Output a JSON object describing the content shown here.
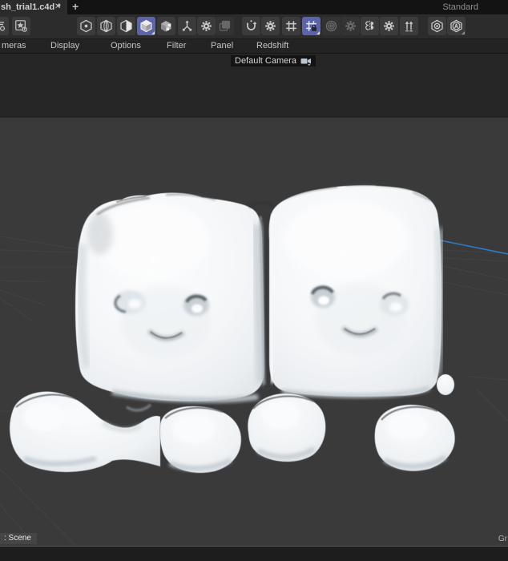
{
  "tab_bar": {
    "tab_title": "sh_trial1.c4d *",
    "close_label": "✕",
    "new_tab_label": "+",
    "layout_label": "Standard"
  },
  "toolbar": {
    "icons": [
      "truncated-left-icon",
      "asset-capsule-icon",
      "shading-dot-hexagon-icon",
      "shading-line-hexagon-icon",
      "shading-half-hexagon-icon",
      "shading-solid-cube-icon",
      "shading-broken-cube-icon",
      "move-axes-icon",
      "move-settings-gear-icon",
      "layers-icon",
      "rotate-u-icon",
      "rotate-settings-gear-icon",
      "grid-icon",
      "grid-lock-icon",
      "rings-icon",
      "rings-settings-gear-icon",
      "symmetry-icon",
      "symmetry-settings-gear-icon",
      "swap-up-arrows-icon",
      "hexagon-eye-icon",
      "hexagon-auto-icon"
    ],
    "selected_color": "#5b63ab"
  },
  "menu_bar": {
    "items": [
      "meras",
      "Display",
      "Options",
      "Filter",
      "Panel",
      "Redshift"
    ]
  },
  "viewport": {
    "camera_label": "Default Camera",
    "bg_top_color": "#262626",
    "bg_bottom_color": "#3a3a3a",
    "grid_line_color": "#4a4a4a",
    "axis_z_color": "#2e7bc5"
  },
  "status_bar": {
    "scene_label": ": Scene",
    "right_truncated_label": "Gr"
  }
}
